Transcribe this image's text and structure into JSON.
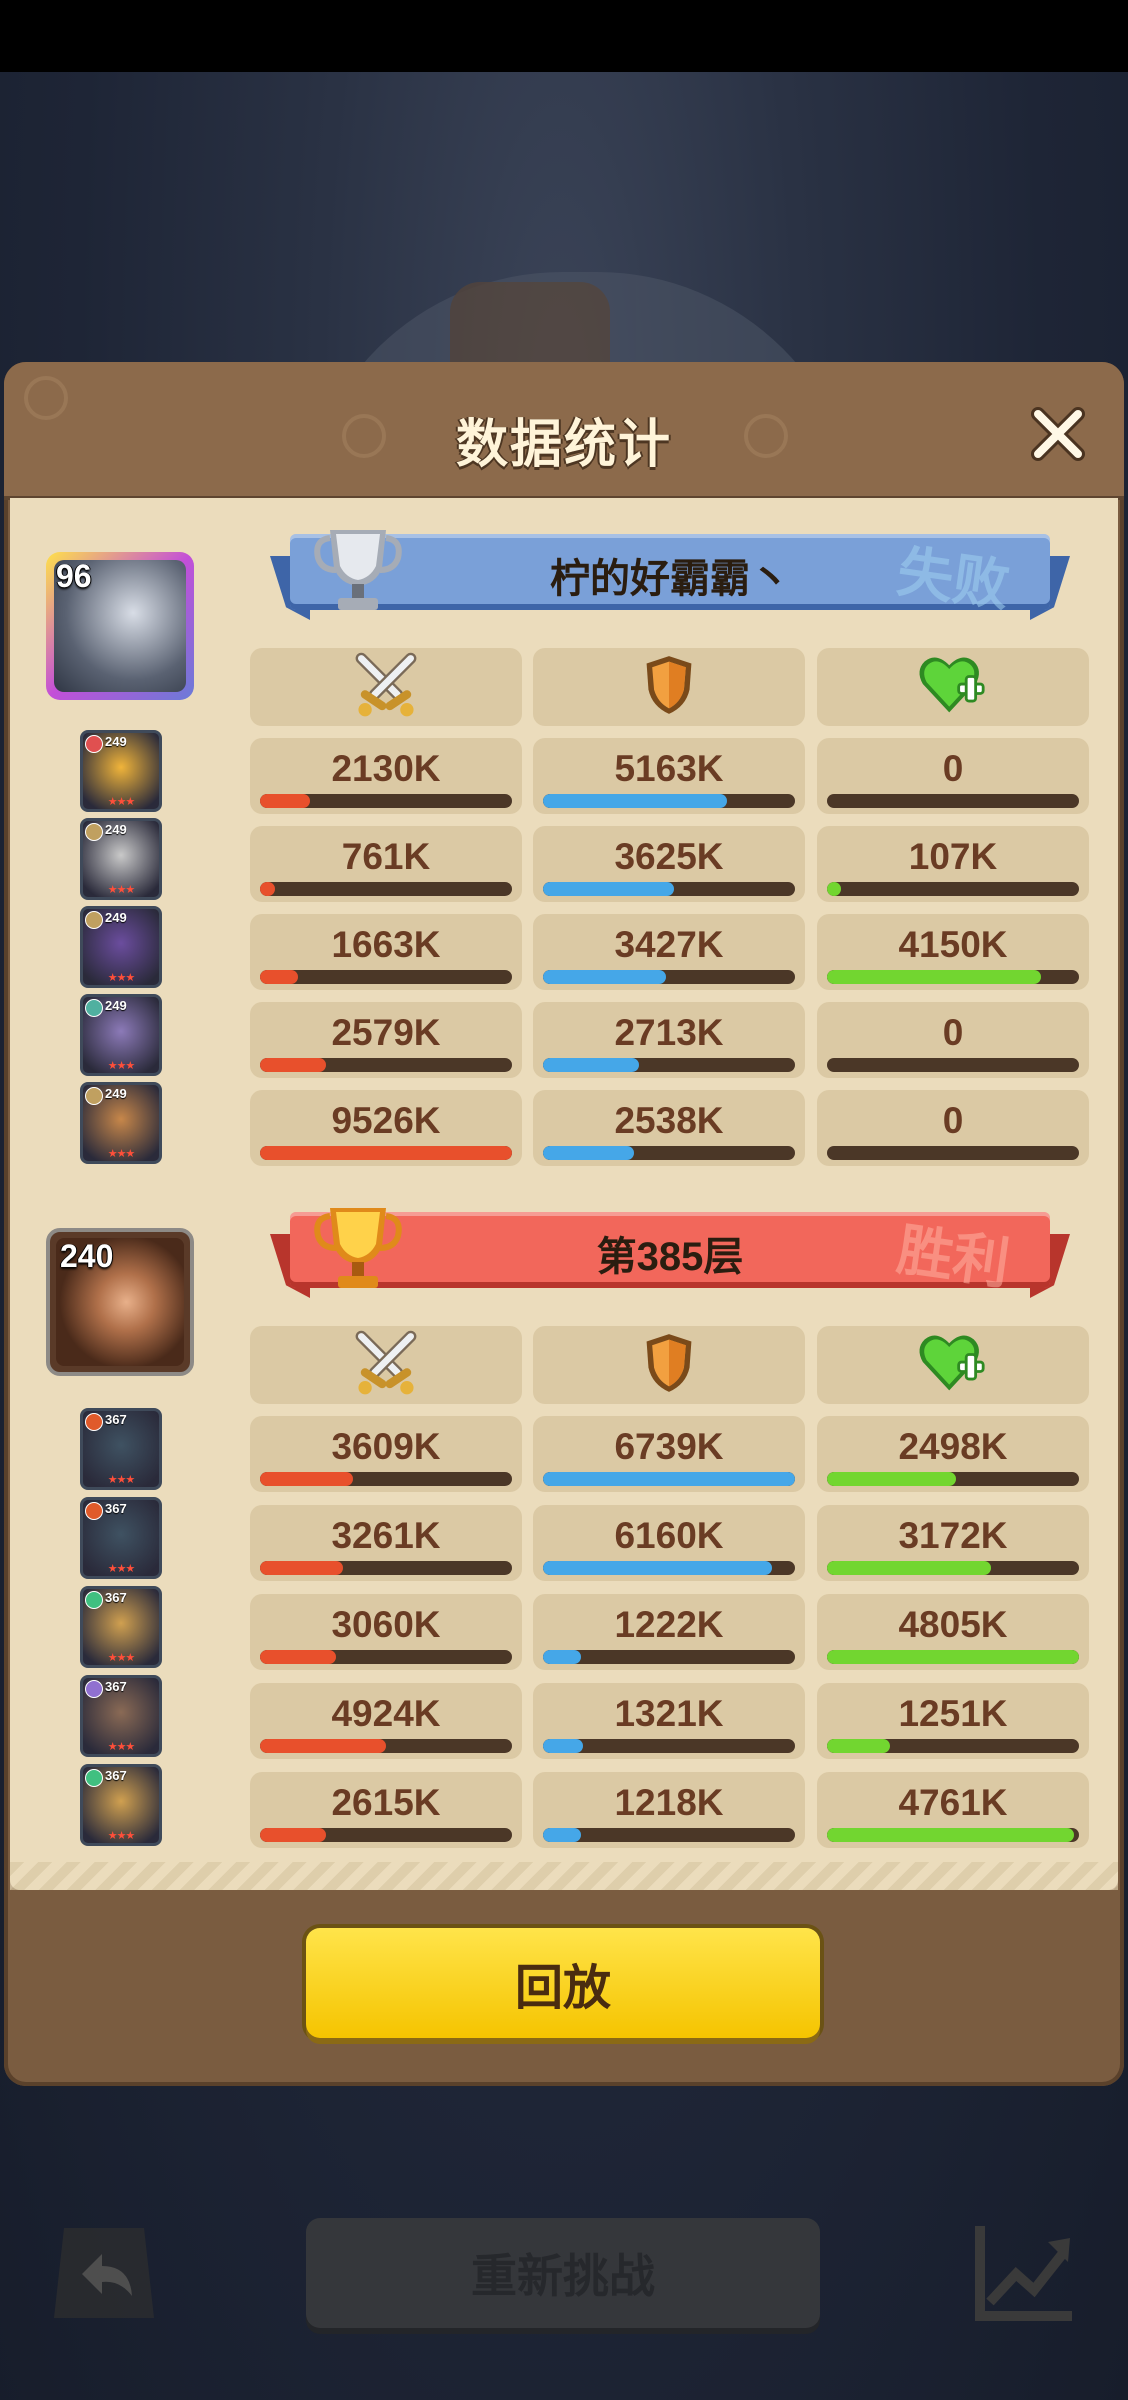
{
  "header": {
    "title": "数据统计"
  },
  "teams": [
    {
      "player_name": "柠的好霸霸丶",
      "result": "失败",
      "player_level": "96",
      "trophy_color": "silver",
      "banner_color": "#7aa0d8",
      "heroes": [
        {
          "level": "249",
          "atk": "2130K",
          "def": "5163K",
          "heal": "0",
          "atk_ratio": 0.2,
          "def_ratio": 0.73,
          "heal_ratio": 0.0
        },
        {
          "level": "249",
          "atk": "761K",
          "def": "3625K",
          "heal": "107K",
          "atk_ratio": 0.06,
          "def_ratio": 0.52,
          "heal_ratio": 0.02
        },
        {
          "level": "249",
          "atk": "1663K",
          "def": "3427K",
          "heal": "4150K",
          "atk_ratio": 0.15,
          "def_ratio": 0.49,
          "heal_ratio": 0.85
        },
        {
          "level": "249",
          "atk": "2579K",
          "def": "2713K",
          "heal": "0",
          "atk_ratio": 0.26,
          "def_ratio": 0.38,
          "heal_ratio": 0.0
        },
        {
          "level": "249",
          "atk": "9526K",
          "def": "2538K",
          "heal": "0",
          "atk_ratio": 1.0,
          "def_ratio": 0.36,
          "heal_ratio": 0.0
        }
      ]
    },
    {
      "player_name": "第385层",
      "result": "胜利",
      "player_level": "240",
      "trophy_color": "gold",
      "banner_color": "#f2675b",
      "heroes": [
        {
          "level": "367",
          "atk": "3609K",
          "def": "6739K",
          "heal": "2498K",
          "atk_ratio": 0.37,
          "def_ratio": 1.0,
          "heal_ratio": 0.51
        },
        {
          "level": "367",
          "atk": "3261K",
          "def": "6160K",
          "heal": "3172K",
          "atk_ratio": 0.33,
          "def_ratio": 0.91,
          "heal_ratio": 0.65
        },
        {
          "level": "367",
          "atk": "3060K",
          "def": "1222K",
          "heal": "4805K",
          "atk_ratio": 0.3,
          "def_ratio": 0.15,
          "heal_ratio": 1.0
        },
        {
          "level": "367",
          "atk": "4924K",
          "def": "1321K",
          "heal": "1251K",
          "atk_ratio": 0.5,
          "def_ratio": 0.16,
          "heal_ratio": 0.25
        },
        {
          "level": "367",
          "atk": "2615K",
          "def": "1218K",
          "heal": "4761K",
          "atk_ratio": 0.26,
          "def_ratio": 0.15,
          "heal_ratio": 0.98
        }
      ]
    }
  ],
  "buttons": {
    "replay": "回放",
    "retry": "重新挑战"
  },
  "colors": {
    "attack": "#e8502c",
    "defense": "#45a7e8",
    "heal": "#72d630",
    "panel": "#ebdcbc"
  },
  "icons": [
    "close-icon",
    "swords-icon",
    "shield-icon",
    "heal-heart-icon",
    "trophy-icon",
    "back-arrow-icon",
    "trend-chart-icon"
  ]
}
